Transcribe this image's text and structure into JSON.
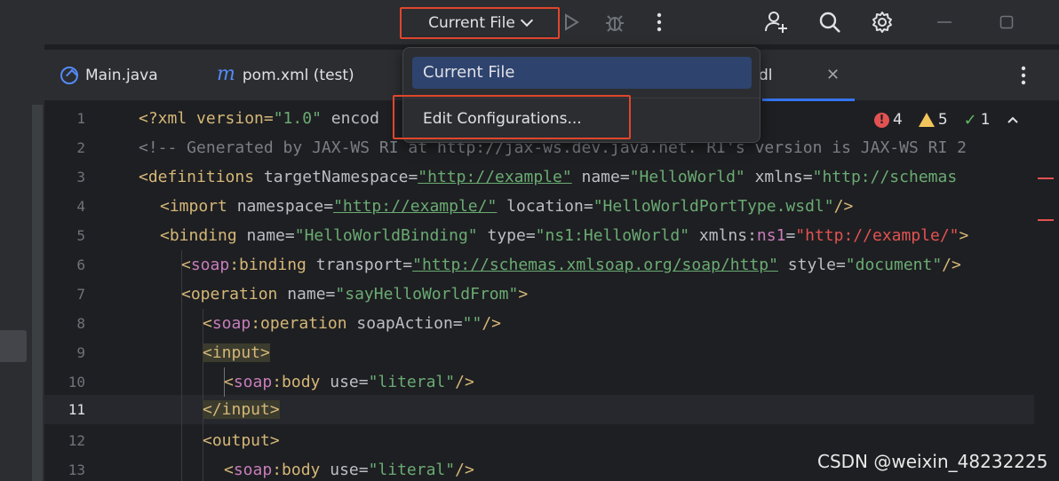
{
  "toolbar": {
    "run_config_label": "Current File"
  },
  "tabs": [
    {
      "label": "Main.java",
      "icon": "java-class-icon"
    },
    {
      "label": "pom.xml (test)",
      "icon": "maven-icon"
    },
    {
      "label": "dl",
      "icon": "wsdl-file-icon"
    }
  ],
  "popup": {
    "selected_item": "Current File",
    "edit_item": "Edit Configurations..."
  },
  "inspections": {
    "errors": "4",
    "warnings": "5",
    "ok": "1"
  },
  "gutter": [
    "1",
    "2",
    "3",
    "4",
    "5",
    "6",
    "7",
    "8",
    "9",
    "10",
    "11",
    "12",
    "13"
  ],
  "code": {
    "l1_a": "<?xml version=",
    "l1_b": "\"1.0\"",
    "l1_c": " encod",
    "l2": "<!-- Generated by JAX-WS RI at http://jax-ws.dev.java.net. RI's version is JAX-WS RI 2",
    "l3_tag": "<definitions",
    "l3_attr1": " targetNamespace=",
    "l3_val1": "\"http://example\"",
    "l3_attr2": " name=",
    "l3_val2": "\"HelloWorld\"",
    "l3_attr3": " xmlns=",
    "l3_val3": "\"http://schemas",
    "l4_tag": "<import",
    "l4_attr1": " namespace=",
    "l4_val1": "\"http://example/\"",
    "l4_attr2": " location=",
    "l4_val2": "\"HelloWorldPortType.wsdl\"",
    "l4_end": "/>",
    "l5_tag": "<binding",
    "l5_attr1": " name=",
    "l5_val1": "\"HelloWorldBinding\"",
    "l5_attr2": " type=",
    "l5_val2": "\"ns1:HelloWorld\"",
    "l5_attr3": " xmlns:",
    "l5_ns": "ns1",
    "l5_eq": "=",
    "l5_val3": "\"http://example/\"",
    "l5_end": ">",
    "l6_open": "<",
    "l6_ns": "soap",
    "l6_tag": ":binding",
    "l6_attr1": " transport=",
    "l6_val1": "\"http://schemas.xmlsoap.org/soap/http\"",
    "l6_attr2": " style=",
    "l6_val2": "\"document\"",
    "l6_end": "/>",
    "l7_tag": "<operation",
    "l7_attr1": " name=",
    "l7_val1": "\"sayHelloWorldFrom\"",
    "l7_end": ">",
    "l8_open": "<",
    "l8_ns": "soap",
    "l8_tag": ":operation",
    "l8_attr1": " soapAction=",
    "l8_val1": "\"\"",
    "l8_end": "/>",
    "l9": "<input>",
    "l10_open": "<",
    "l10_ns": "soap",
    "l10_tag": ":body",
    "l10_attr1": " use=",
    "l10_val1": "\"literal\"",
    "l10_end": "/>",
    "l11": "</input>",
    "l12": "<output>",
    "l13_open": "<",
    "l13_ns": "soap",
    "l13_tag": ":body",
    "l13_attr1": " use=",
    "l13_val1": "\"literal\"",
    "l13_end": "/>"
  },
  "watermark": "CSDN @weixin_48232225",
  "colors": {
    "accent": "#3574f0",
    "highlight_border": "#e0462d",
    "selection": "#2e436e"
  }
}
